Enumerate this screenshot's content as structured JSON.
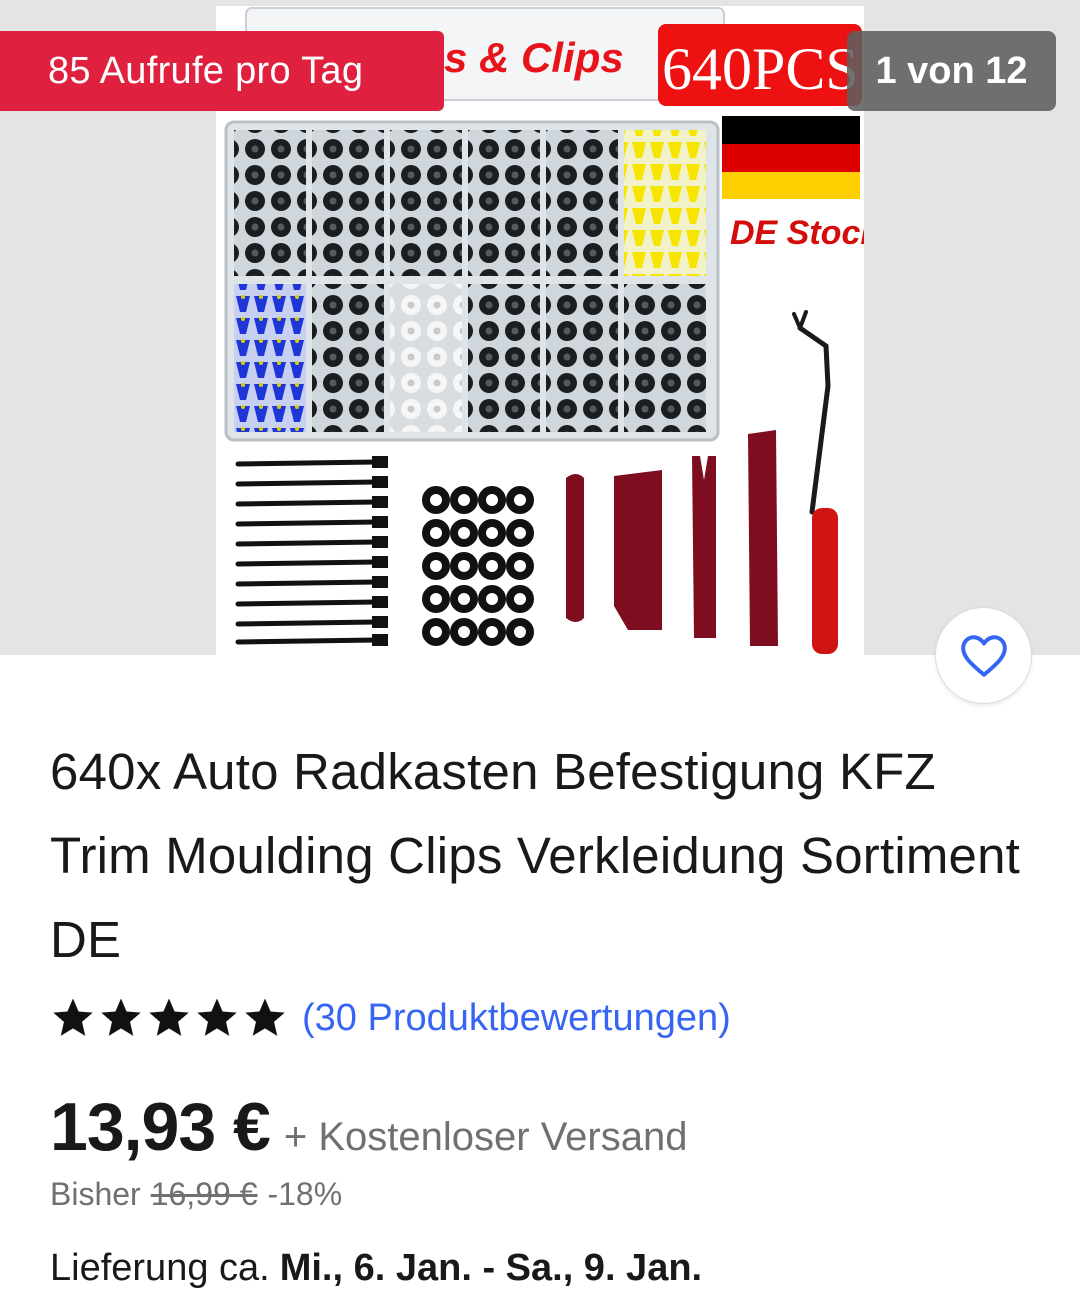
{
  "gallery": {
    "views_badge": "85 Aufrufe pro Tag",
    "counter": "1 von 12",
    "image_overlay": {
      "banner_text": "s & Clips",
      "pcs_label": "640PCS",
      "stock_label": "DE Stock"
    },
    "favorite_icon": "heart-outline-icon"
  },
  "product": {
    "title": "640x Auto Radkasten Befestigung KFZ Trim Moulding Clips Verkleidung Sortiment DE",
    "rating": {
      "stars": 5,
      "reviews": "(30 Produktbewertungen)"
    },
    "price": "13,93 €",
    "shipping": "+ Kostenloser Versand",
    "previous_label": "Bisher",
    "previous_price": "16,99 €",
    "discount": "-18%",
    "delivery_label": "Lieferung ca.",
    "delivery_dates": "Mi., 6. Jan. - Sa., 9. Jan."
  },
  "colors": {
    "badge_red": "#e0203f",
    "link_blue": "#3665f3",
    "secondary_text": "#707070"
  }
}
